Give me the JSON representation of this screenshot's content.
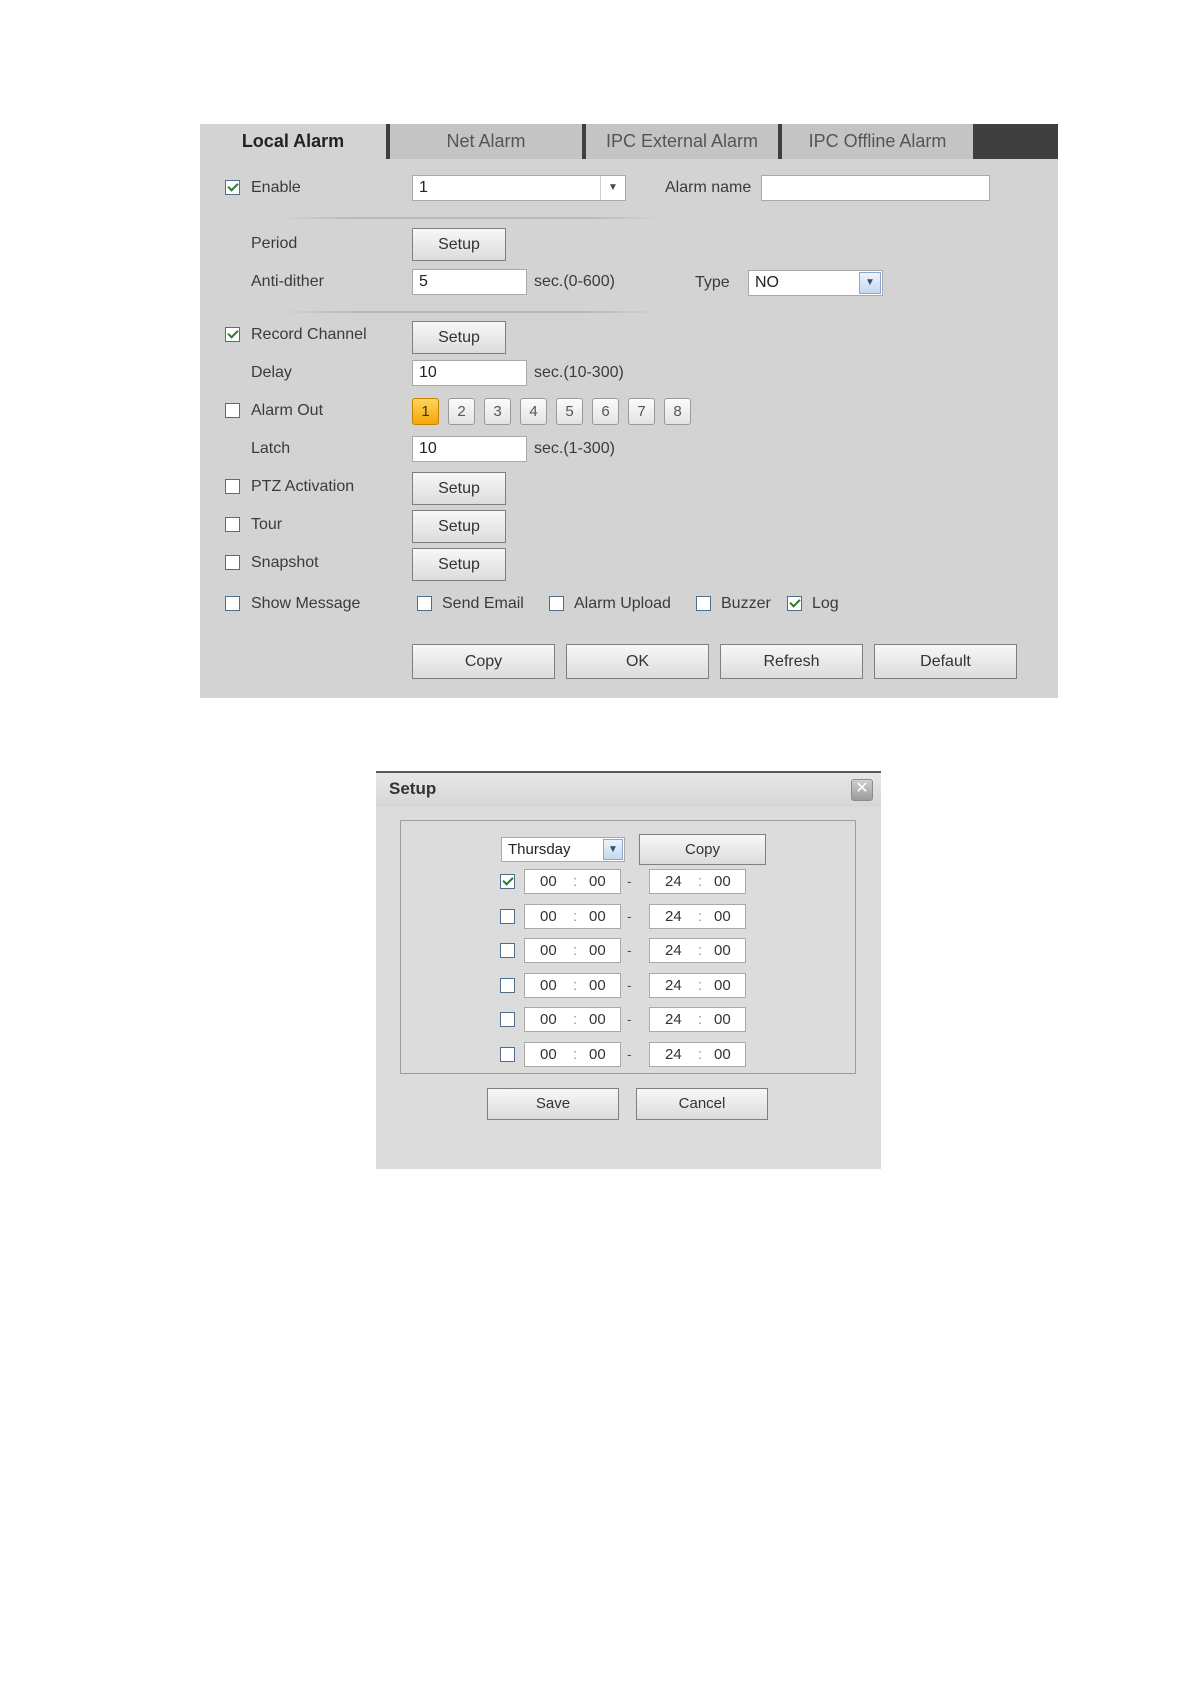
{
  "alarm_panel": {
    "tabs": [
      "Local Alarm",
      "Net Alarm",
      "IPC External Alarm",
      "IPC Offline Alarm"
    ],
    "active_tab": "Local Alarm",
    "enable": {
      "label": "Enable",
      "checked": true
    },
    "channel_select": {
      "value": "1"
    },
    "alarm_name": {
      "label": "Alarm name",
      "value": ""
    },
    "period": {
      "label": "Period",
      "button": "Setup"
    },
    "anti_dither": {
      "label": "Anti-dither",
      "value": "5",
      "unit": "sec.(0-600)"
    },
    "type": {
      "label": "Type",
      "value": "NO"
    },
    "record_channel": {
      "label": "Record Channel",
      "checked": true,
      "button": "Setup"
    },
    "delay": {
      "label": "Delay",
      "value": "10",
      "unit": "sec.(10-300)"
    },
    "alarm_out": {
      "label": "Alarm Out",
      "checked": false,
      "channels": [
        "1",
        "2",
        "3",
        "4",
        "5",
        "6",
        "7",
        "8"
      ],
      "active_channel": "1"
    },
    "latch": {
      "label": "Latch",
      "value": "10",
      "unit": "sec.(1-300)"
    },
    "ptz_activation": {
      "label": "PTZ Activation",
      "checked": false,
      "button": "Setup"
    },
    "tour": {
      "label": "Tour",
      "checked": false,
      "button": "Setup"
    },
    "snapshot": {
      "label": "Snapshot",
      "checked": false,
      "button": "Setup"
    },
    "show_message": {
      "label": "Show Message",
      "checked": false
    },
    "send_email": {
      "label": "Send Email",
      "checked": false
    },
    "alarm_upload": {
      "label": "Alarm Upload",
      "checked": false
    },
    "buzzer": {
      "label": "Buzzer",
      "checked": false
    },
    "log": {
      "label": "Log",
      "checked": true
    },
    "actions": {
      "copy": "Copy",
      "ok": "OK",
      "refresh": "Refresh",
      "default": "Default"
    }
  },
  "setup_dialog": {
    "title": "Setup",
    "close_icon": "close-icon",
    "day_select": "Thursday",
    "copy_button": "Copy",
    "periods": [
      {
        "checked": true,
        "start_h": "00",
        "start_m": "00",
        "end_h": "24",
        "end_m": "00"
      },
      {
        "checked": false,
        "start_h": "00",
        "start_m": "00",
        "end_h": "24",
        "end_m": "00"
      },
      {
        "checked": false,
        "start_h": "00",
        "start_m": "00",
        "end_h": "24",
        "end_m": "00"
      },
      {
        "checked": false,
        "start_h": "00",
        "start_m": "00",
        "end_h": "24",
        "end_m": "00"
      },
      {
        "checked": false,
        "start_h": "00",
        "start_m": "00",
        "end_h": "24",
        "end_m": "00"
      },
      {
        "checked": false,
        "start_h": "00",
        "start_m": "00",
        "end_h": "24",
        "end_m": "00"
      }
    ],
    "separator": ":",
    "range_dash": "-",
    "save_button": "Save",
    "cancel_button": "Cancel"
  }
}
